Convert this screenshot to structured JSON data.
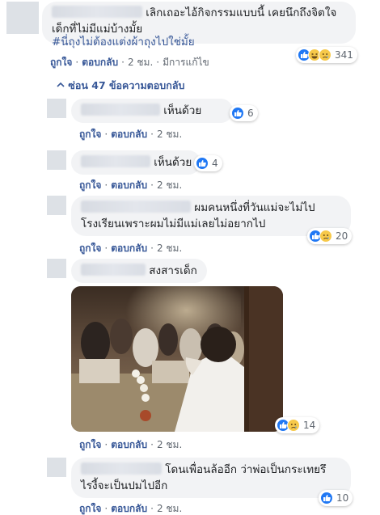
{
  "top_comment": {
    "text_line1": "เลิกเถอะไอ้กิจกรรมแบบนี้ เคยนึกถึงจิตใจ",
    "text_line2": "เด็กที่ไม่มีแม่บ้างมั้ย",
    "hashtag": "#นี่ถุงไม่ต้องแต่งผ้าถุงไปใช่มั้ย",
    "reaction_count": "341",
    "like": "ถูกใจ",
    "reply": "ตอบกลับ",
    "time": "2 ชม.",
    "edited": "มีการแก้ไข"
  },
  "replies_toggle": "ซ่อน 47 ข้อความตอบกลับ",
  "replies": [
    {
      "text": "เห็นด้วย",
      "reaction_count": "6",
      "like": "ถูกใจ",
      "reply": "ตอบกลับ",
      "time": "2 ชม."
    },
    {
      "text": "เห็นด้วย",
      "reaction_count": "4",
      "like": "ถูกใจ",
      "reply": "ตอบกลับ",
      "time": "2 ชม."
    },
    {
      "text_line1": "ผมคนหนึ่งที่วันแม่จะไม่ไป",
      "text_line2": "โรงเรียนเพราะผมไม่มีแม่เลยไม่อยากไป",
      "reaction_count": "20",
      "like": "ถูกใจ",
      "reply": "ตอบกลับ",
      "time": "2 ชม."
    },
    {
      "text": "สงสารเด็ก",
      "reaction_count": "14",
      "like": "ถูกใจ",
      "reply": "ตอบกลับ",
      "time": "2 ชม."
    },
    {
      "text_line1": "โดนเพื่อนล้ออีก ว่าพ่อเป็นกระเทยรึ",
      "text_line2": "ไรงี้จะเป็นปมไปอีก",
      "reaction_count": "10",
      "like": "ถูกใจ",
      "reply": "ตอบกลับ",
      "time": "2 ชม."
    }
  ],
  "icons": {
    "like": "thumbs-up-icon",
    "haha": "laughing-emoji-icon",
    "sad": "sad-emoji-icon",
    "toggle": "chevron-up-icon"
  },
  "colors": {
    "link": "#385898",
    "bubble": "#f2f3f5",
    "like_blue": "#2078f4",
    "emoji_yellow": "#f7c94a"
  }
}
